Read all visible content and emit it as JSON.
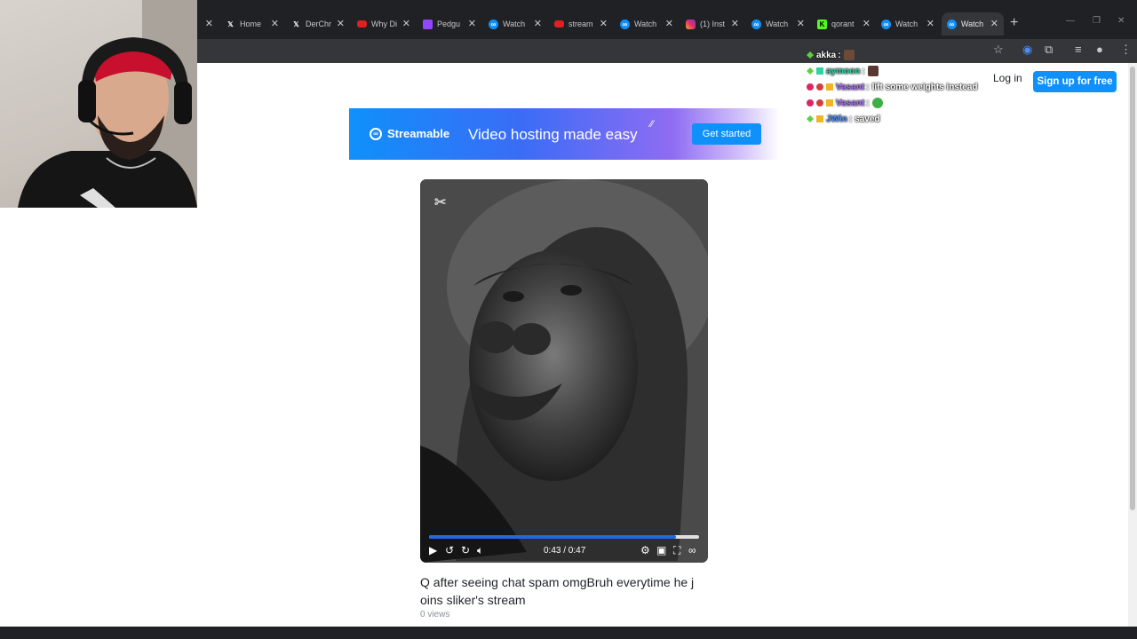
{
  "browser": {
    "tabs": [
      {
        "title": "",
        "favicon": "none"
      },
      {
        "title": "Home",
        "favicon": "x-logo-icon"
      },
      {
        "title": "DerChr",
        "favicon": "x-logo-icon"
      },
      {
        "title": "Why Di",
        "favicon": "youtube-icon"
      },
      {
        "title": "Pedgu",
        "favicon": "twitch-icon"
      },
      {
        "title": "Watch",
        "favicon": "streamable-icon"
      },
      {
        "title": "stream",
        "favicon": "youtube-icon"
      },
      {
        "title": "Watch",
        "favicon": "streamable-icon"
      },
      {
        "title": "(1) Inst",
        "favicon": "instagram-icon"
      },
      {
        "title": "Watch",
        "favicon": "streamable-icon"
      },
      {
        "title": "qorant",
        "favicon": "kick-icon"
      },
      {
        "title": "Watch",
        "favicon": "streamable-icon"
      },
      {
        "title": "Watch",
        "favicon": "streamable-icon",
        "active": true
      }
    ],
    "new_tab_glyph": "+"
  },
  "header": {
    "login_label": "Log in",
    "signup_label": "Sign up for free"
  },
  "banner": {
    "brand": "Streamable",
    "tagline": "Video hosting made easy",
    "cta_label": "Get started"
  },
  "player": {
    "timecode": "0:43 / 0:47",
    "progress": 0.915
  },
  "video": {
    "title": "Q after seeing chat spam omgBruh everytime he j oins sliker's stream",
    "views": "0 views"
  },
  "chat": {
    "messages": [
      {
        "user": "akka",
        "user_color": "#ffffff",
        "message": ""
      },
      {
        "user": "aymoon",
        "user_color": "#2fd1a5",
        "message": ""
      },
      {
        "user": "Vasant",
        "user_color": "#a970ff",
        "message": "lift some weights instead"
      },
      {
        "user": "Vasant",
        "user_color": "#a970ff",
        "message": ""
      },
      {
        "user": "JWin",
        "user_color": "#4b8df8",
        "message": "saved"
      }
    ]
  },
  "colors": {
    "accent": "#0f90fa",
    "progress": "#1e6be0"
  }
}
